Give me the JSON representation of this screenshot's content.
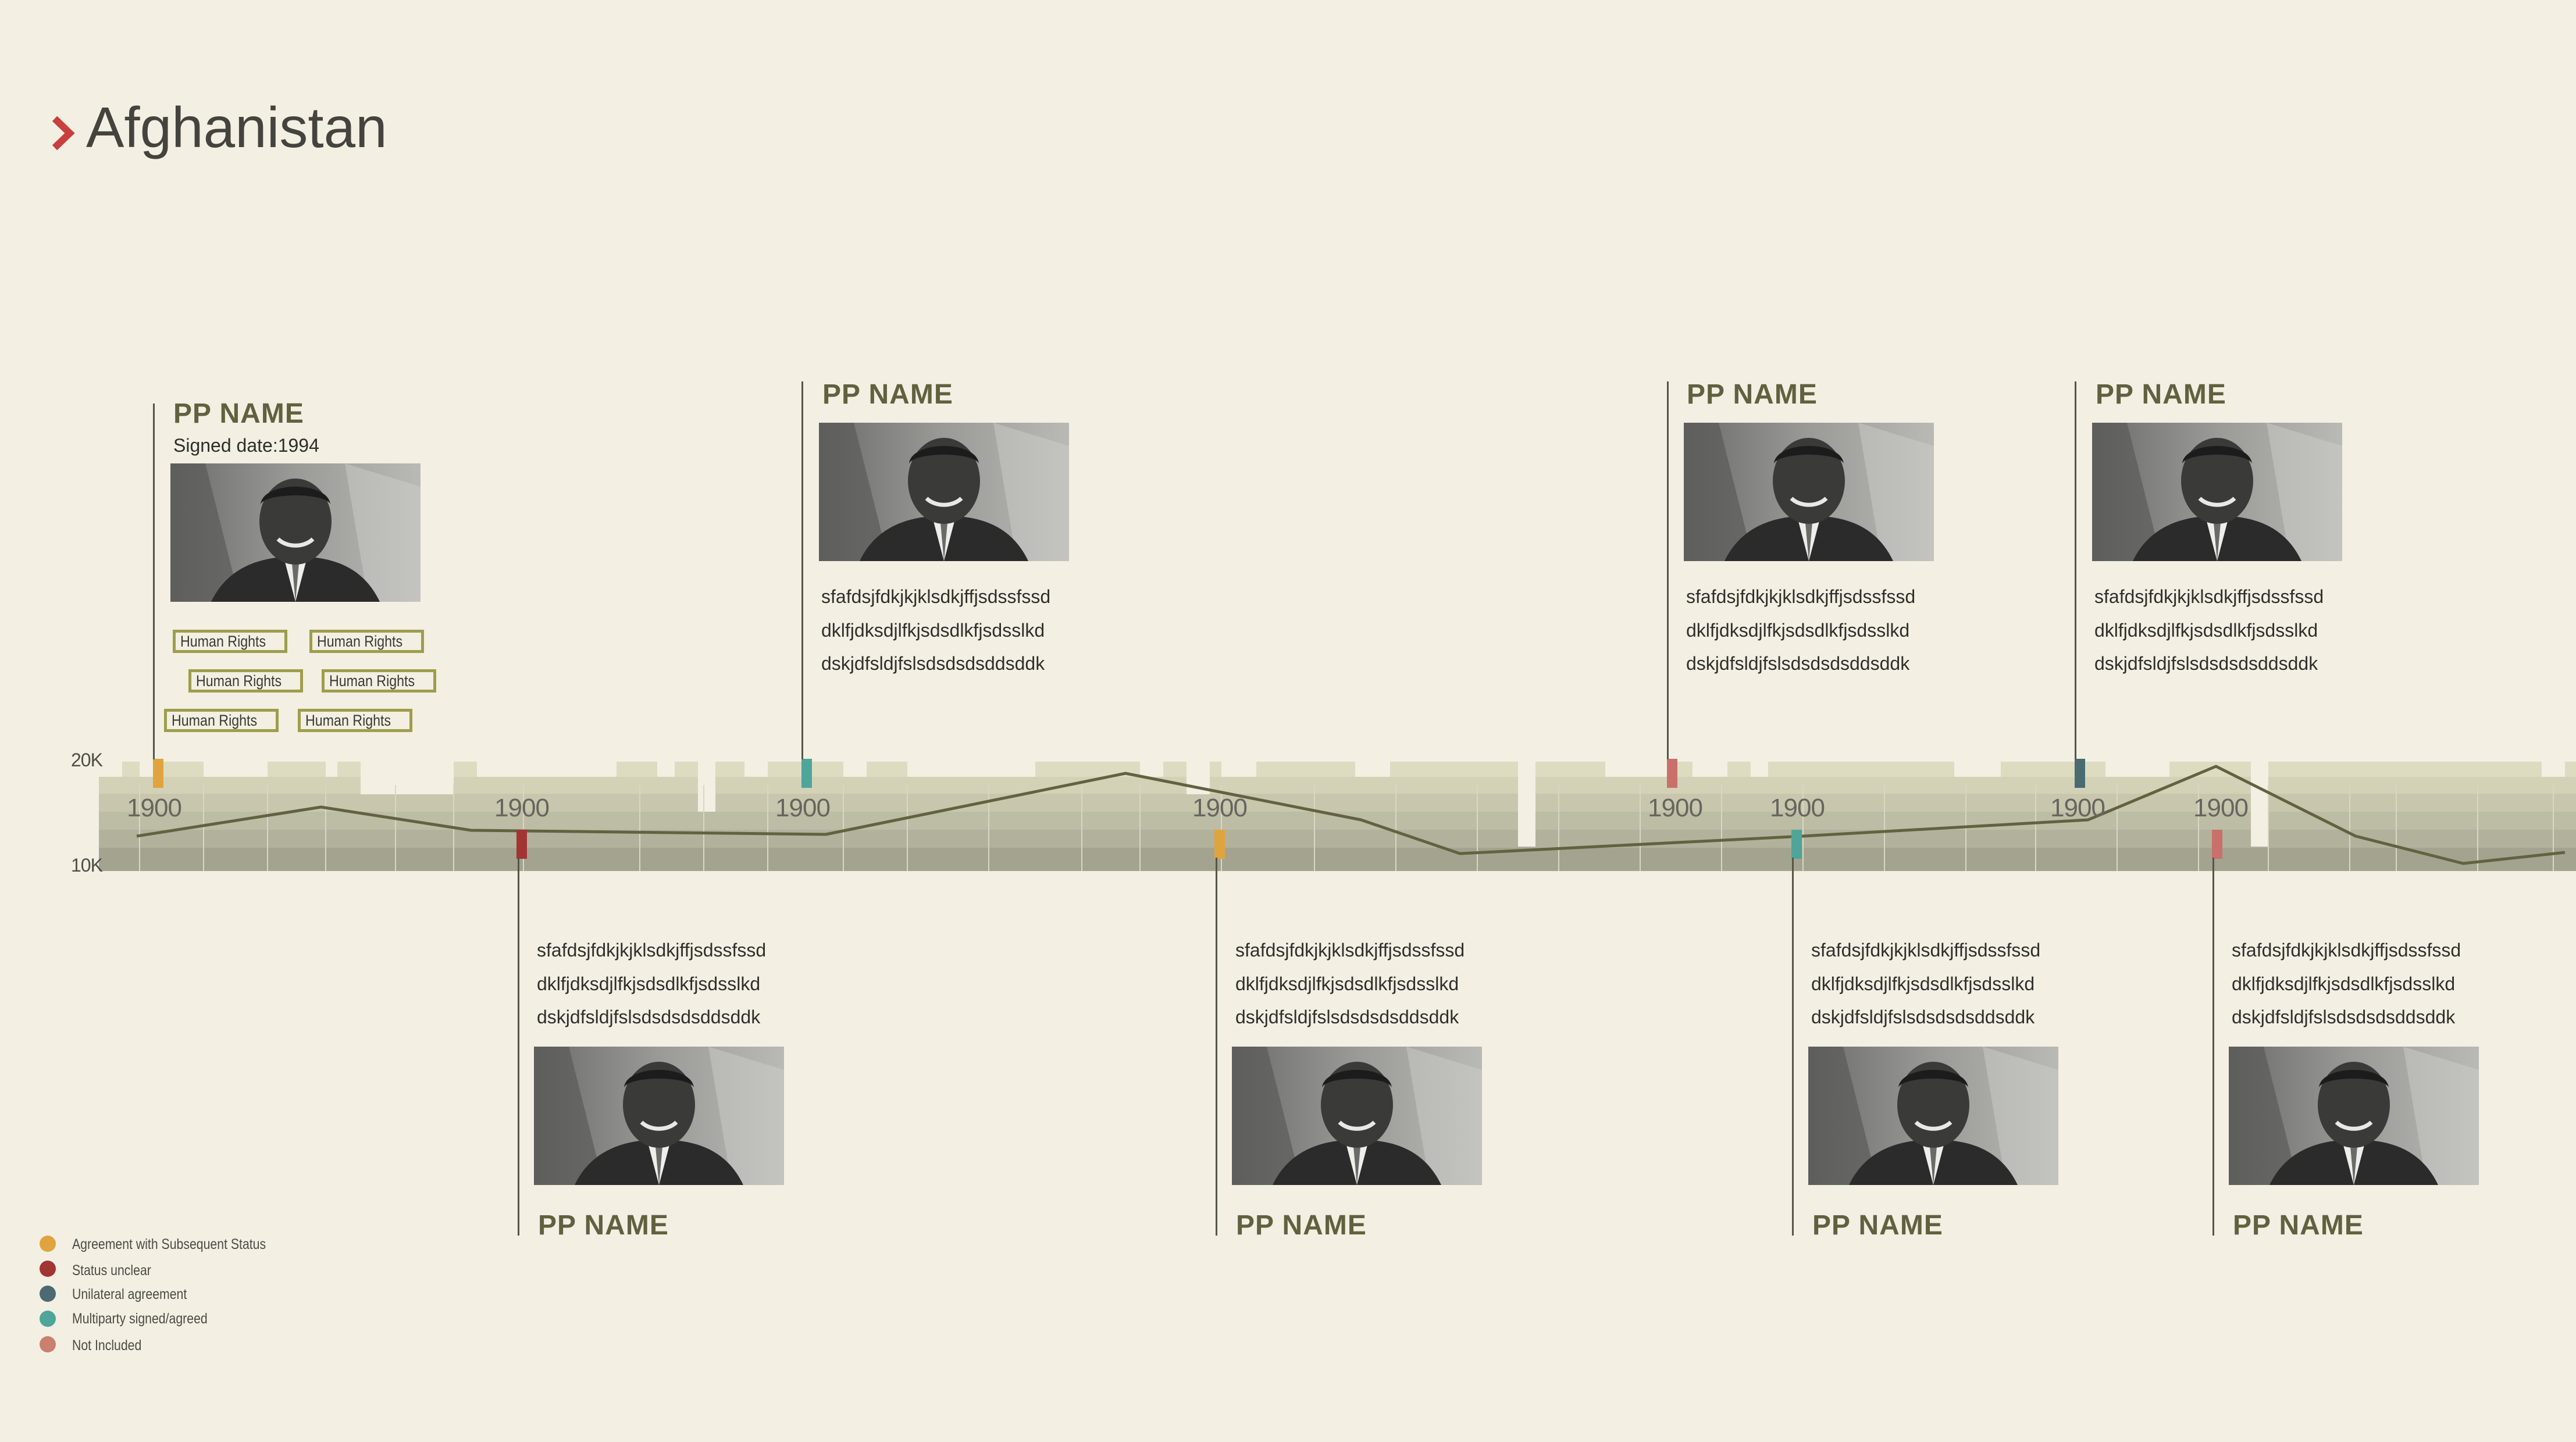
{
  "page": {
    "title": "Afghanistan"
  },
  "colors": {
    "background": "#f3efe3",
    "accent_chevron": "#c8403d",
    "title_text": "#44433d",
    "card_title": "#62613f",
    "trend_line": "#626241",
    "tag_border": "#9e9d4c"
  },
  "axis": {
    "top_label": "20K",
    "bottom_label": "10K"
  },
  "years": [
    "1900",
    "1900",
    "1900",
    "1900",
    "1900",
    "1900",
    "1900",
    "1900"
  ],
  "top_cards": [
    {
      "name": "PP NAME",
      "signed_date": "Signed date:1994",
      "tags": [
        "Human Rights",
        "Human Rights",
        "Human Rights",
        "Human Rights",
        "Human Rights",
        "Human Rights"
      ],
      "status_color": "#e0a43e"
    },
    {
      "name": "PP NAME",
      "lines": [
        "sfafdsjfdkjkjklsdkjffjsdssfssd",
        "dklfjdksdjlfkjsdsdlkfjsdsslkd",
        "dskjdfsldjfslsdsdsdsddsddk"
      ],
      "status_color": "#4fa59a"
    },
    {
      "name": "PP NAME",
      "lines": [
        "sfafdsjfdkjkjklsdkjffjsdssfssd",
        "dklfjdksdjlfkjsdsdlkfjsdsslkd",
        "dskjdfsldjfslsdsdsdsddsddk"
      ],
      "status_color": "#c9706a"
    },
    {
      "name": "PP NAME",
      "lines": [
        "sfafdsjfdkjkjklsdkjffjsdssfssd",
        "dklfjdksdjlfkjsdsdlkfjsdsslkd",
        "dskjdfsldjfslsdsdsdsddsddk"
      ],
      "status_color": "#4b6a72"
    }
  ],
  "bottom_cards": [
    {
      "name": "PP NAME",
      "lines": [
        "sfafdsjfdkjkjklsdkjffjsdssfssd",
        "dklfjdksdjlfkjsdsdlkfjsdsslkd",
        "dskjdfsldjfslsdsdsdsddsddk"
      ],
      "status_color": "#a33434"
    },
    {
      "name": "PP NAME",
      "lines": [
        "sfafdsjfdkjkjklsdkjffjsdssfssd",
        "dklfjdksdjlfkjsdsdlkfjsdsslkd",
        "dskjdfsldjfslsdsdsdsddsddk"
      ],
      "status_color": "#e0a43e"
    },
    {
      "name": "PP NAME",
      "lines": [
        "sfafdsjfdkjkjklsdkjffjsdssfssd",
        "dklfjdksdjlfkjsdsdlkfjsdsslkd",
        "dskjdfsldjfslsdsdsdsddsddk"
      ],
      "status_color": "#4fa59a"
    },
    {
      "name": "PP NAME",
      "lines": [
        "sfafdsjfdkjkjklsdkjffjsdssfssd",
        "dklfjdksdjlfkjsdsdlkfjsdsslkd",
        "dskjdfsldjfslsdsdsdsddsddk"
      ],
      "status_color": "#c9706a"
    }
  ],
  "legend": [
    {
      "label": "Agreement with Subsequent Status",
      "color": "#e0a43e"
    },
    {
      "label": "Status unclear",
      "color": "#a33434"
    },
    {
      "label": "Unilateral agreement",
      "color": "#4b6a72"
    },
    {
      "label": "Multiparty signed/agreed",
      "color": "#4fa59a"
    },
    {
      "label": "Not Included",
      "color": "#c9806e"
    }
  ]
}
